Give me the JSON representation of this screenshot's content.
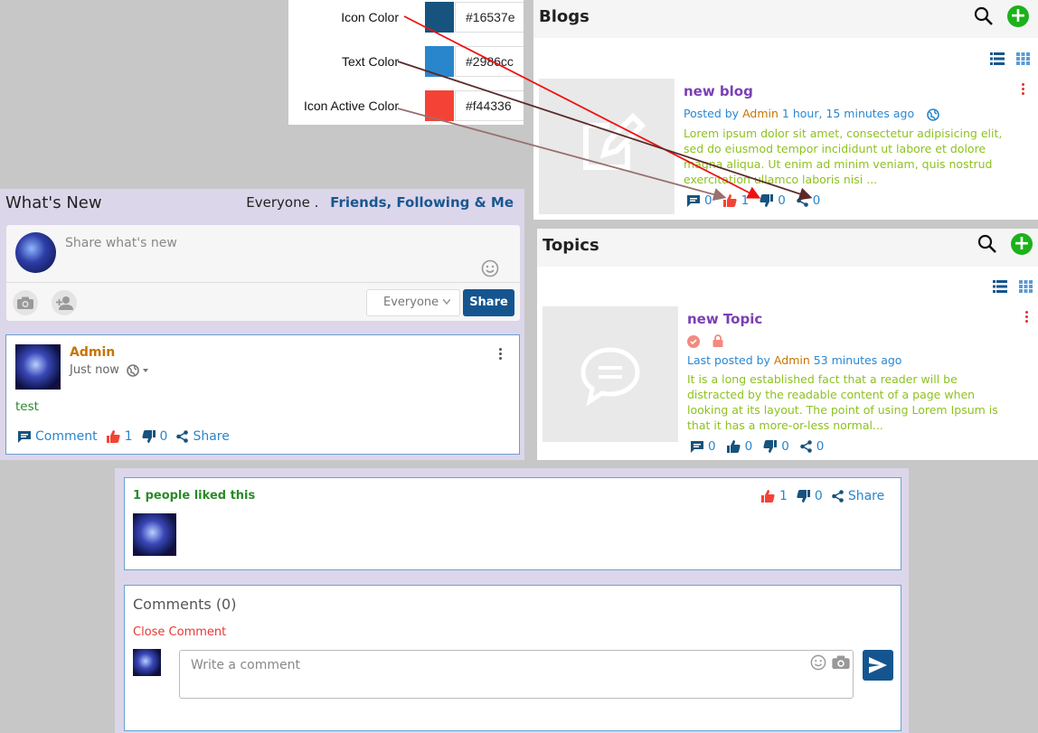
{
  "legend": {
    "rows": [
      {
        "label": "Icon Color",
        "hex": "#16537e",
        "color": "#16537e"
      },
      {
        "label": "Text Color",
        "hex": "#2986cc",
        "color": "#2986cc"
      },
      {
        "label": "Icon Active Color",
        "hex": "#f44336",
        "color": "#f44336"
      }
    ]
  },
  "blogs": {
    "title": "Blogs",
    "item": {
      "title": "new blog",
      "posted_by": "Posted by",
      "author": "Admin",
      "time": "1 hour, 15 minutes ago",
      "description": "Lorem ipsum dolor sit amet, consectetur adipisicing elit, sed do eiusmod tempor incididunt ut labore et dolore magna aliqua. Ut enim ad minim veniam, quis nostrud exercitation ullamco laboris nisi ...",
      "comments": "0",
      "likes": "1",
      "dislikes": "0",
      "shares": "0"
    }
  },
  "topics": {
    "title": "Topics",
    "item": {
      "title": "new Topic",
      "posted_by": "Last posted by",
      "author": "Admin",
      "time": "53 minutes ago",
      "description": "It is a long established fact that a reader will be distracted by the readable content of a page when looking at its layout. The point of using Lorem Ipsum is that it has a more-or-less normal...",
      "comments": "0",
      "likes": "0",
      "dislikes": "0",
      "shares": "0"
    }
  },
  "whats_new": {
    "title": "What's New",
    "filter_everyone": "Everyone",
    "filter_sep": ".",
    "filter_active": "Friends, Following & Me",
    "composer_placeholder": "Share what's new",
    "privacy_select": "Everyone",
    "share_button": "Share",
    "post": {
      "author": "Admin",
      "time": "Just now",
      "text": "test",
      "comment_label": "Comment",
      "likes": "1",
      "dislikes": "0",
      "share_label": "Share"
    }
  },
  "likes_panel": {
    "title": "1 people liked this",
    "likes": "1",
    "dislikes": "0",
    "share_label": "Share"
  },
  "comments_panel": {
    "title": "Comments (0)",
    "close_label": "Close Comment",
    "placeholder": "Write a comment"
  },
  "colors": {
    "icon": "#16537e",
    "text": "#2986cc",
    "icon_active": "#f44336",
    "add": "#1bb21b"
  }
}
